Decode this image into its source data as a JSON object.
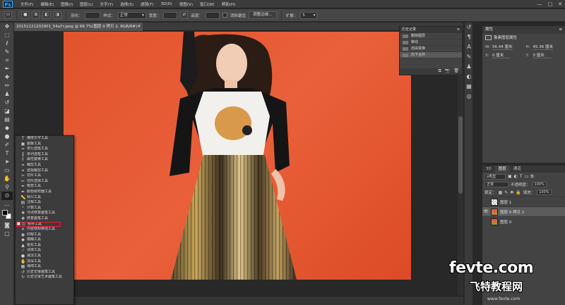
{
  "app": {
    "logo": "Ps",
    "menu": [
      "文件(F)",
      "编辑(E)",
      "图像(I)",
      "图层(L)",
      "文字(Y)",
      "选择(S)",
      "滤镜(T)",
      "3D(D)",
      "视图(V)",
      "窗口(W)",
      "帮助(H)"
    ],
    "window_controls": [
      "—",
      "□",
      "✕"
    ]
  },
  "options": {
    "feather_label": "羽化：",
    "style_label": "样式：",
    "style_value": "正常",
    "smooth_label": "消除锯齿",
    "width_label": "宽度：",
    "height_label": "高度：",
    "refine_edge": "调整边缘...",
    "expand_label": "扩展：",
    "expand_value": "5"
  },
  "document": {
    "tab_title": "20151121202901_54aYr.jpeg @ 66.7%(图层 0 拷贝 2, RGB/8#) *",
    "tab_close": "×"
  },
  "tool_flyout": {
    "items": [
      {
        "label": "横排文字工具",
        "icon": "text-icon"
      },
      {
        "label": "画板工具",
        "icon": "artboard-icon"
      },
      {
        "label": "单行选框工具",
        "icon": "row-marquee-icon"
      },
      {
        "label": "单列选框工具",
        "icon": "column-marquee-icon"
      },
      {
        "label": "磁性套索工具",
        "icon": "magnetic-lasso-icon"
      },
      {
        "label": "裁剪工具",
        "icon": "crop-icon"
      },
      {
        "label": "透视裁剪工具",
        "icon": "perspective-crop-icon"
      },
      {
        "label": "切片工具",
        "icon": "slice-icon"
      },
      {
        "label": "切片选择工具",
        "icon": "slice-select-icon"
      },
      {
        "label": "吸管工具",
        "icon": "eyedropper-icon"
      },
      {
        "label": "颜色取样器工具",
        "icon": "color-sampler-icon"
      },
      {
        "label": "标尺工具",
        "icon": "ruler-icon"
      },
      {
        "label": "注释工具",
        "icon": "note-icon"
      },
      {
        "label": "计数工具",
        "icon": "count-icon"
      },
      {
        "label": "污点修复画笔工具",
        "icon": "spot-heal-icon"
      },
      {
        "label": "修复画笔工具",
        "icon": "heal-brush-icon"
      },
      {
        "label": "修补工具",
        "icon": "patch-icon",
        "selected": true,
        "highlighted": true
      },
      {
        "label": "内容感知移动工具",
        "icon": "content-aware-icon"
      },
      {
        "label": "红眼工具",
        "icon": "red-eye-icon"
      },
      {
        "label": "模糊工具",
        "icon": "blur-icon"
      },
      {
        "label": "锐化工具",
        "icon": "sharpen-icon"
      },
      {
        "label": "涂抹工具",
        "icon": "smudge-icon"
      },
      {
        "label": "减淡工具",
        "icon": "dodge-icon"
      },
      {
        "label": "加深工具",
        "icon": "burn-icon"
      },
      {
        "label": "海绵工具",
        "icon": "sponge-icon"
      },
      {
        "label": "历史记录画笔工具",
        "icon": "history-brush-icon"
      },
      {
        "label": "历史记录艺术画笔工具",
        "icon": "art-history-brush-icon"
      }
    ]
  },
  "history": {
    "title": "历史记录",
    "rows": [
      {
        "label": "删除图层",
        "selected": false
      },
      {
        "label": "移动",
        "selected": false
      },
      {
        "label": "自由变换",
        "selected": false
      },
      {
        "label": "向下合并",
        "selected": true
      }
    ]
  },
  "properties": {
    "title": "属性",
    "subtitle": "像素图层属性",
    "w_label": "W:",
    "w_value": "56.44 厘米",
    "h_label": "H:",
    "h_value": "45.36 厘米",
    "x_label": "X:",
    "x_value": "0 厘米",
    "y_label": "Y:",
    "y_value": "0 厘米"
  },
  "layers": {
    "tabs": [
      "3D",
      "图层",
      "通道"
    ],
    "active_tab": 1,
    "kind_label": "ρ类型",
    "blend_mode": "正常",
    "opacity_label": "不透明度：",
    "opacity_value": "100%",
    "lock_label": "锁定：",
    "fill_label": "填充：",
    "fill_value": "100%",
    "rows": [
      {
        "name": "图层 1",
        "visible": false,
        "thumb": "transparent",
        "selected": false
      },
      {
        "name": "图层 0 拷贝 2",
        "visible": true,
        "thumb": "photo",
        "selected": true
      },
      {
        "name": "图层 0",
        "visible": false,
        "thumb": "photo",
        "selected": false
      }
    ]
  },
  "watermark": {
    "main": "fevte.com",
    "sub": "飞特教程网",
    "url": "www.fevte.com"
  },
  "colors": {
    "background_orange": "#e2532d",
    "highlight_red": "#e2202a"
  }
}
